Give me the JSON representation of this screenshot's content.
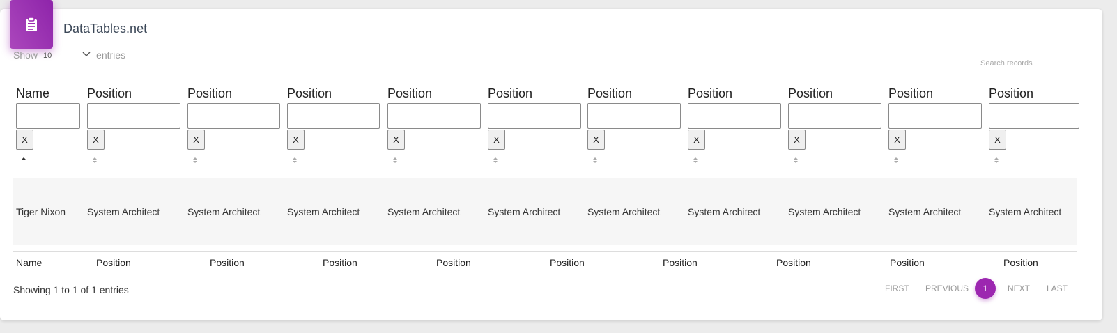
{
  "card": {
    "title": "DataTables.net",
    "header_icon": "clipboard-icon",
    "accent": "#9c27b0"
  },
  "length": {
    "show_label": "Show",
    "value": "10",
    "entries_label": "entries"
  },
  "search": {
    "placeholder": "Search records"
  },
  "columns": [
    {
      "header": "Name",
      "filter_value": "",
      "clear_label": "X",
      "sort": "asc",
      "footer": "Name"
    },
    {
      "header": "Position",
      "filter_value": "",
      "clear_label": "X",
      "sort": "both",
      "footer": "Position"
    },
    {
      "header": "Position",
      "filter_value": "",
      "clear_label": "X",
      "sort": "both",
      "footer": "Position"
    },
    {
      "header": "Position",
      "filter_value": "",
      "clear_label": "X",
      "sort": "both",
      "footer": "Position"
    },
    {
      "header": "Position",
      "filter_value": "",
      "clear_label": "X",
      "sort": "both",
      "footer": "Position"
    },
    {
      "header": "Position",
      "filter_value": "",
      "clear_label": "X",
      "sort": "both",
      "footer": "Position"
    },
    {
      "header": "Position",
      "filter_value": "",
      "clear_label": "X",
      "sort": "both",
      "footer": "Position"
    },
    {
      "header": "Position",
      "filter_value": "",
      "clear_label": "X",
      "sort": "both",
      "footer": "Position"
    },
    {
      "header": "Position",
      "filter_value": "",
      "clear_label": "X",
      "sort": "both",
      "footer": "Position"
    },
    {
      "header": "Position",
      "filter_value": "",
      "clear_label": "X",
      "sort": "both",
      "footer": "Position"
    },
    {
      "header": "Position",
      "filter_value": "",
      "clear_label": "X",
      "sort": "both",
      "footer": ""
    }
  ],
  "rows": [
    [
      "Tiger Nixon",
      "System Architect",
      "System Architect",
      "System Architect",
      "System Architect",
      "System Architect",
      "System Architect",
      "System Architect",
      "System Architect",
      "System Architect",
      "System Architect"
    ]
  ],
  "info": "Showing 1 to 1 of 1 entries",
  "pagination": {
    "first": "FIRST",
    "previous": "PREVIOUS",
    "current": "1",
    "next": "NEXT",
    "last": "LAST"
  }
}
